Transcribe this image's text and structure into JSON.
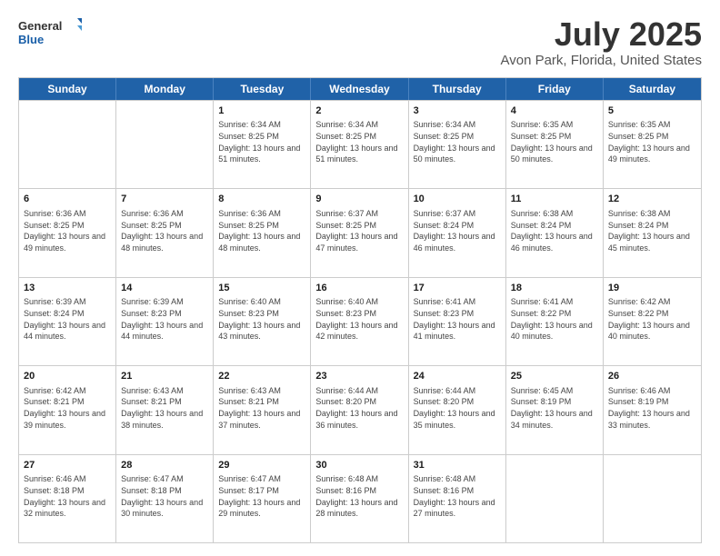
{
  "header": {
    "logo": {
      "general": "General",
      "blue": "Blue"
    },
    "title": "July 2025",
    "location": "Avon Park, Florida, United States"
  },
  "weekdays": [
    "Sunday",
    "Monday",
    "Tuesday",
    "Wednesday",
    "Thursday",
    "Friday",
    "Saturday"
  ],
  "weeks": [
    [
      {
        "day": "",
        "sunrise": "",
        "sunset": "",
        "daylight": ""
      },
      {
        "day": "",
        "sunrise": "",
        "sunset": "",
        "daylight": ""
      },
      {
        "day": "1",
        "sunrise": "Sunrise: 6:34 AM",
        "sunset": "Sunset: 8:25 PM",
        "daylight": "Daylight: 13 hours and 51 minutes."
      },
      {
        "day": "2",
        "sunrise": "Sunrise: 6:34 AM",
        "sunset": "Sunset: 8:25 PM",
        "daylight": "Daylight: 13 hours and 51 minutes."
      },
      {
        "day": "3",
        "sunrise": "Sunrise: 6:34 AM",
        "sunset": "Sunset: 8:25 PM",
        "daylight": "Daylight: 13 hours and 50 minutes."
      },
      {
        "day": "4",
        "sunrise": "Sunrise: 6:35 AM",
        "sunset": "Sunset: 8:25 PM",
        "daylight": "Daylight: 13 hours and 50 minutes."
      },
      {
        "day": "5",
        "sunrise": "Sunrise: 6:35 AM",
        "sunset": "Sunset: 8:25 PM",
        "daylight": "Daylight: 13 hours and 49 minutes."
      }
    ],
    [
      {
        "day": "6",
        "sunrise": "Sunrise: 6:36 AM",
        "sunset": "Sunset: 8:25 PM",
        "daylight": "Daylight: 13 hours and 49 minutes."
      },
      {
        "day": "7",
        "sunrise": "Sunrise: 6:36 AM",
        "sunset": "Sunset: 8:25 PM",
        "daylight": "Daylight: 13 hours and 48 minutes."
      },
      {
        "day": "8",
        "sunrise": "Sunrise: 6:36 AM",
        "sunset": "Sunset: 8:25 PM",
        "daylight": "Daylight: 13 hours and 48 minutes."
      },
      {
        "day": "9",
        "sunrise": "Sunrise: 6:37 AM",
        "sunset": "Sunset: 8:25 PM",
        "daylight": "Daylight: 13 hours and 47 minutes."
      },
      {
        "day": "10",
        "sunrise": "Sunrise: 6:37 AM",
        "sunset": "Sunset: 8:24 PM",
        "daylight": "Daylight: 13 hours and 46 minutes."
      },
      {
        "day": "11",
        "sunrise": "Sunrise: 6:38 AM",
        "sunset": "Sunset: 8:24 PM",
        "daylight": "Daylight: 13 hours and 46 minutes."
      },
      {
        "day": "12",
        "sunrise": "Sunrise: 6:38 AM",
        "sunset": "Sunset: 8:24 PM",
        "daylight": "Daylight: 13 hours and 45 minutes."
      }
    ],
    [
      {
        "day": "13",
        "sunrise": "Sunrise: 6:39 AM",
        "sunset": "Sunset: 8:24 PM",
        "daylight": "Daylight: 13 hours and 44 minutes."
      },
      {
        "day": "14",
        "sunrise": "Sunrise: 6:39 AM",
        "sunset": "Sunset: 8:23 PM",
        "daylight": "Daylight: 13 hours and 44 minutes."
      },
      {
        "day": "15",
        "sunrise": "Sunrise: 6:40 AM",
        "sunset": "Sunset: 8:23 PM",
        "daylight": "Daylight: 13 hours and 43 minutes."
      },
      {
        "day": "16",
        "sunrise": "Sunrise: 6:40 AM",
        "sunset": "Sunset: 8:23 PM",
        "daylight": "Daylight: 13 hours and 42 minutes."
      },
      {
        "day": "17",
        "sunrise": "Sunrise: 6:41 AM",
        "sunset": "Sunset: 8:23 PM",
        "daylight": "Daylight: 13 hours and 41 minutes."
      },
      {
        "day": "18",
        "sunrise": "Sunrise: 6:41 AM",
        "sunset": "Sunset: 8:22 PM",
        "daylight": "Daylight: 13 hours and 40 minutes."
      },
      {
        "day": "19",
        "sunrise": "Sunrise: 6:42 AM",
        "sunset": "Sunset: 8:22 PM",
        "daylight": "Daylight: 13 hours and 40 minutes."
      }
    ],
    [
      {
        "day": "20",
        "sunrise": "Sunrise: 6:42 AM",
        "sunset": "Sunset: 8:21 PM",
        "daylight": "Daylight: 13 hours and 39 minutes."
      },
      {
        "day": "21",
        "sunrise": "Sunrise: 6:43 AM",
        "sunset": "Sunset: 8:21 PM",
        "daylight": "Daylight: 13 hours and 38 minutes."
      },
      {
        "day": "22",
        "sunrise": "Sunrise: 6:43 AM",
        "sunset": "Sunset: 8:21 PM",
        "daylight": "Daylight: 13 hours and 37 minutes."
      },
      {
        "day": "23",
        "sunrise": "Sunrise: 6:44 AM",
        "sunset": "Sunset: 8:20 PM",
        "daylight": "Daylight: 13 hours and 36 minutes."
      },
      {
        "day": "24",
        "sunrise": "Sunrise: 6:44 AM",
        "sunset": "Sunset: 8:20 PM",
        "daylight": "Daylight: 13 hours and 35 minutes."
      },
      {
        "day": "25",
        "sunrise": "Sunrise: 6:45 AM",
        "sunset": "Sunset: 8:19 PM",
        "daylight": "Daylight: 13 hours and 34 minutes."
      },
      {
        "day": "26",
        "sunrise": "Sunrise: 6:46 AM",
        "sunset": "Sunset: 8:19 PM",
        "daylight": "Daylight: 13 hours and 33 minutes."
      }
    ],
    [
      {
        "day": "27",
        "sunrise": "Sunrise: 6:46 AM",
        "sunset": "Sunset: 8:18 PM",
        "daylight": "Daylight: 13 hours and 32 minutes."
      },
      {
        "day": "28",
        "sunrise": "Sunrise: 6:47 AM",
        "sunset": "Sunset: 8:18 PM",
        "daylight": "Daylight: 13 hours and 30 minutes."
      },
      {
        "day": "29",
        "sunrise": "Sunrise: 6:47 AM",
        "sunset": "Sunset: 8:17 PM",
        "daylight": "Daylight: 13 hours and 29 minutes."
      },
      {
        "day": "30",
        "sunrise": "Sunrise: 6:48 AM",
        "sunset": "Sunset: 8:16 PM",
        "daylight": "Daylight: 13 hours and 28 minutes."
      },
      {
        "day": "31",
        "sunrise": "Sunrise: 6:48 AM",
        "sunset": "Sunset: 8:16 PM",
        "daylight": "Daylight: 13 hours and 27 minutes."
      },
      {
        "day": "",
        "sunrise": "",
        "sunset": "",
        "daylight": ""
      },
      {
        "day": "",
        "sunrise": "",
        "sunset": "",
        "daylight": ""
      }
    ]
  ]
}
